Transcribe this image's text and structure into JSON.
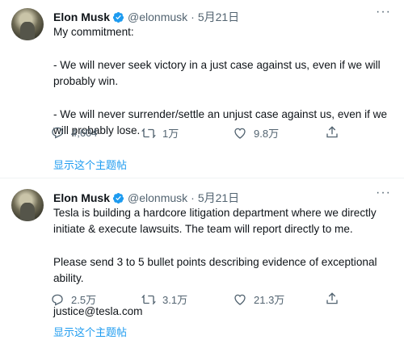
{
  "tweets": [
    {
      "author": {
        "name": "Elon Musk",
        "handle": "@elonmusk",
        "date": "5月21日"
      },
      "paragraphs": [
        "My commitment:",
        "- We will never seek victory in a just case against us, even if we will probably win.",
        "- We will never surrender/settle an unjust case against us, even if we will probably lose."
      ],
      "stats": {
        "replies": "4,604",
        "retweets": "1万",
        "likes": "9.8万"
      },
      "show_thread": "显示这个主题帖"
    },
    {
      "author": {
        "name": "Elon Musk",
        "handle": "@elonmusk",
        "date": "5月21日"
      },
      "paragraphs": [
        "Tesla is building a hardcore litigation department where we directly initiate & execute lawsuits. The team will report directly to me.",
        "Please send 3 to 5 bullet points describing evidence of exceptional ability.",
        "justice@tesla.com"
      ],
      "stats": {
        "replies": "2.5万",
        "retweets": "3.1万",
        "likes": "21.3万"
      },
      "show_thread": "显示这个主题帖"
    }
  ],
  "colors": {
    "accent": "#1d9bf0",
    "text": "#0f1419",
    "muted": "#536471"
  },
  "icons": [
    "verified-badge-icon",
    "more-icon",
    "reply-icon",
    "retweet-icon",
    "like-icon",
    "share-icon"
  ]
}
